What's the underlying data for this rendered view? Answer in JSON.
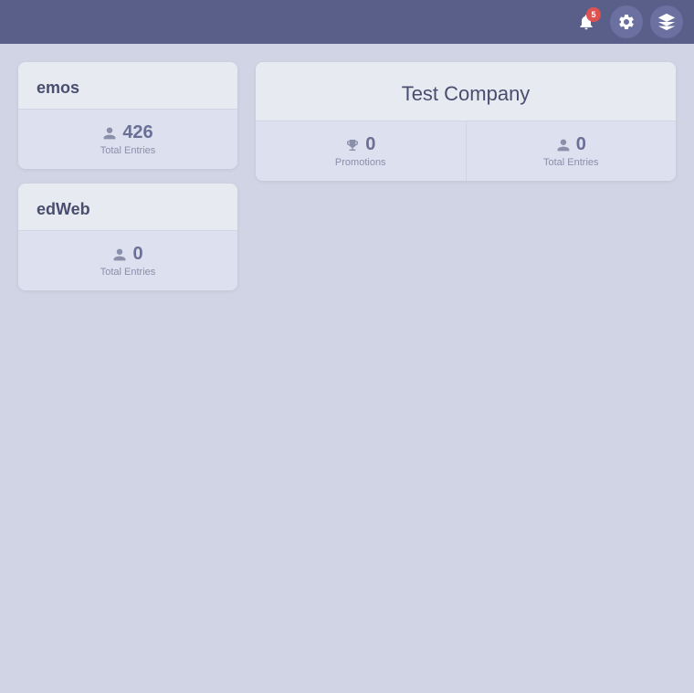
{
  "navbar": {
    "notification_count": "5",
    "icons": {
      "notification": "🔔",
      "gear": "⚙",
      "dice": "⬡"
    }
  },
  "left_cards": [
    {
      "title": "emos",
      "stats": [
        {
          "icon": "person",
          "value": "426",
          "label": "Total Entries"
        }
      ]
    },
    {
      "title": "edWeb",
      "stats": [
        {
          "icon": "person",
          "value": "0",
          "label": "Total Entries"
        }
      ]
    }
  ],
  "main_card": {
    "title": "Test Company",
    "stats": [
      {
        "icon": "trophy",
        "value": "0",
        "label": "Promotions"
      },
      {
        "icon": "person",
        "value": "0",
        "label": "Total Entries"
      }
    ]
  }
}
